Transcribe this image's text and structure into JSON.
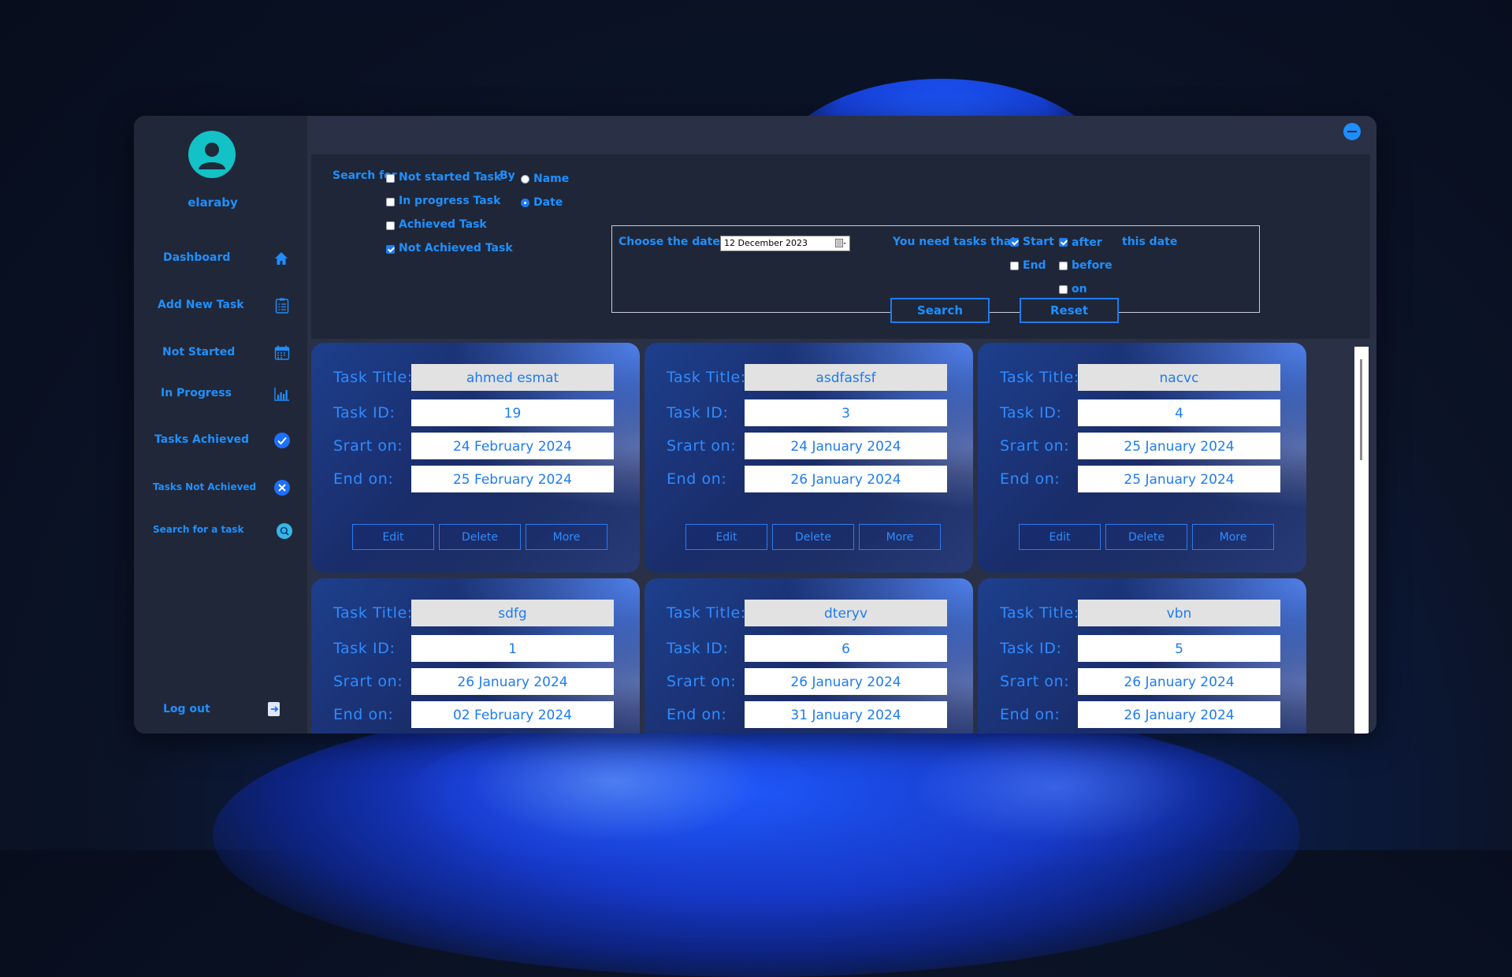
{
  "user": {
    "name": "elaraby"
  },
  "sidebar": {
    "items": [
      {
        "label": "Dashboard",
        "icon": "home-icon"
      },
      {
        "label": "Add New Task",
        "icon": "clipboard-list-icon"
      },
      {
        "label": "Not Started",
        "icon": "calendar-icon"
      },
      {
        "label": "In Progress",
        "icon": "bar-chart-icon"
      },
      {
        "label": "Tasks Achieved",
        "icon": "check-circle-icon"
      },
      {
        "label": "Tasks Not Achieved",
        "icon": "x-circle-icon"
      },
      {
        "label": "Search for a task",
        "icon": "search-circle-icon"
      }
    ],
    "logout": {
      "label": "Log out",
      "icon": "logout-icon"
    }
  },
  "search": {
    "search_for_label": "Search for",
    "status_options": [
      {
        "label": "Not started Task",
        "checked": false
      },
      {
        "label": "In progress Task",
        "checked": false
      },
      {
        "label": "Achieved Task",
        "checked": false
      },
      {
        "label": "Not Achieved Task",
        "checked": true
      }
    ],
    "by_label": "By",
    "by_options": [
      {
        "label": "Name",
        "selected": false
      },
      {
        "label": "Date",
        "selected": true
      }
    ],
    "choose_date_label": "Choose the date :",
    "date_value": "12 December 2023",
    "need_tasks_label": "You need tasks that",
    "point_options": [
      {
        "label": "Start",
        "checked": true
      },
      {
        "label": "End",
        "checked": false
      }
    ],
    "relation_options": [
      {
        "label": "after",
        "checked": true
      },
      {
        "label": "before",
        "checked": false
      },
      {
        "label": "on",
        "checked": false
      }
    ],
    "this_date_label": "this date",
    "search_button": "Search",
    "reset_button": "Reset"
  },
  "card_labels": {
    "title": "Task Title:",
    "id": "Task ID:",
    "start": "Srart on:",
    "end": "End on:",
    "edit": "Edit",
    "delete": "Delete",
    "more": "More"
  },
  "tasks": [
    {
      "title": "ahmed esmat",
      "id": "19",
      "start": "24 February 2024",
      "end": "25 February 2024"
    },
    {
      "title": "asdfasfsf",
      "id": "3",
      "start": "24 January 2024",
      "end": "26 January 2024"
    },
    {
      "title": "nacvc",
      "id": "4",
      "start": "25 January 2024",
      "end": "25 January 2024"
    },
    {
      "title": "sdfg",
      "id": "1",
      "start": "26 January 2024",
      "end": "02 February 2024"
    },
    {
      "title": "dteryv",
      "id": "6",
      "start": "26 January 2024",
      "end": "31 January 2024"
    },
    {
      "title": "vbn",
      "id": "5",
      "start": "26 January 2024",
      "end": "26 January 2024"
    }
  ],
  "colors": {
    "accent": "#1e90ff",
    "sidebar_bg": "#202739",
    "content_bg": "#2a3045",
    "panel_bg": "#1f2638"
  }
}
